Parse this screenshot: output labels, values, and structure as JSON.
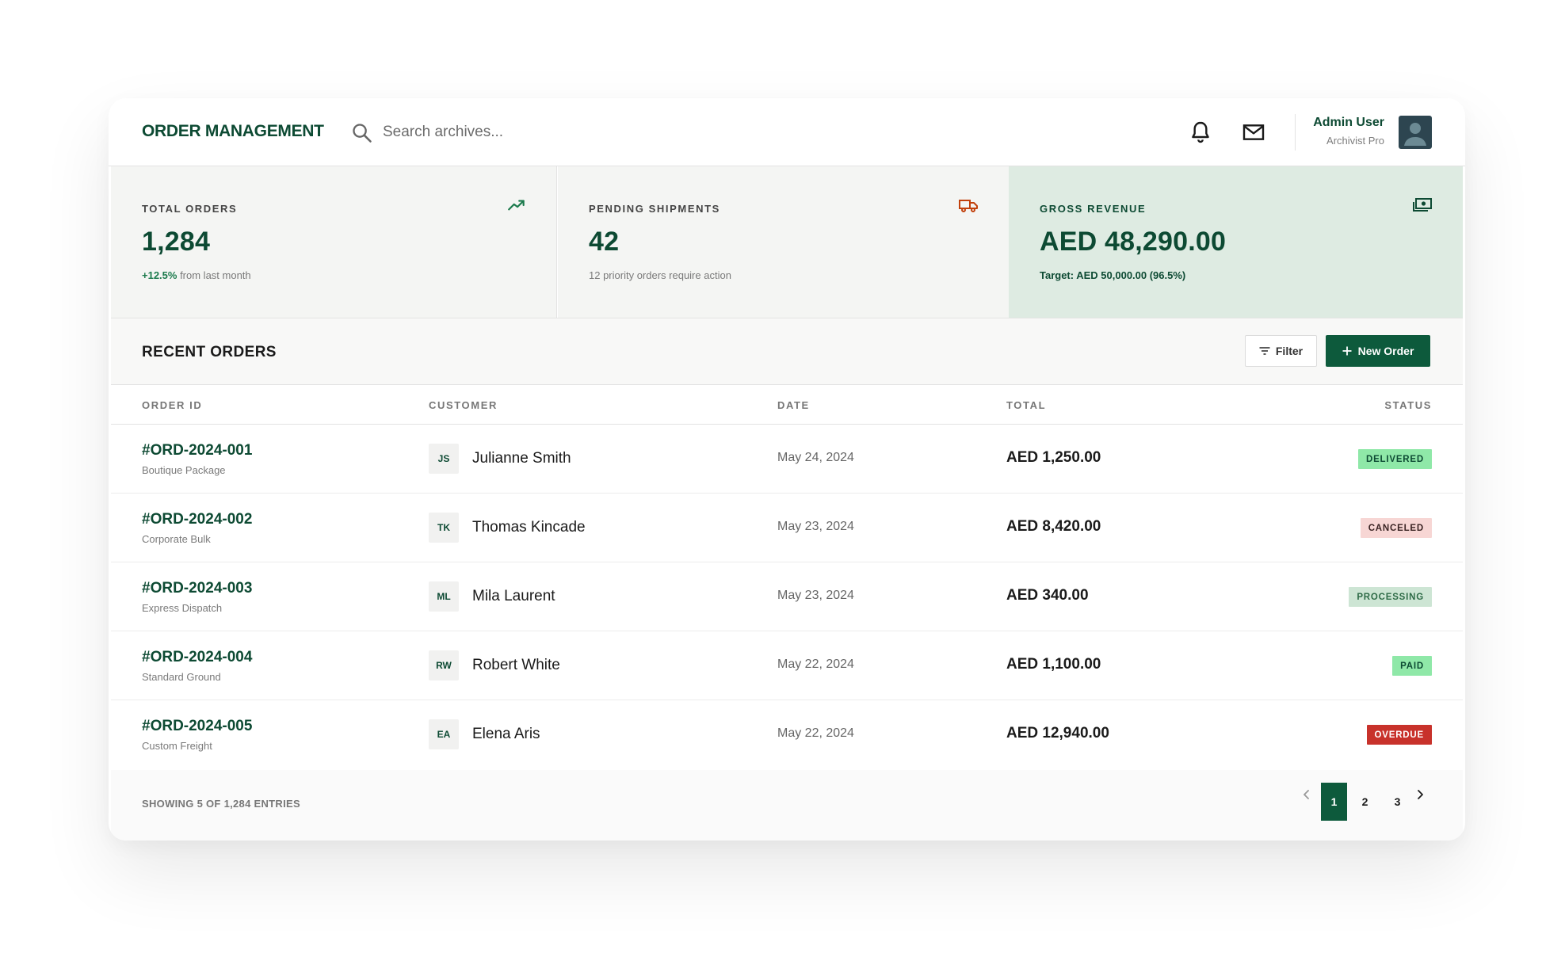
{
  "header": {
    "logo": "ORDER MANAGEMENT",
    "search_placeholder": "Search archives...",
    "user_name": "Admin User",
    "user_role": "Archivist Pro"
  },
  "stats": [
    {
      "label": "TOTAL ORDERS",
      "value": "1,284",
      "sub_highlight": "+12.5%",
      "sub_text": " from last month",
      "icon": "trending-up-icon"
    },
    {
      "label": "PENDING SHIPMENTS",
      "value": "42",
      "sub_text": "12 priority orders require action",
      "icon": "truck-icon"
    },
    {
      "label": "GROSS REVENUE",
      "value": "AED 48,290.00",
      "sub_text": "Target: AED 50,000.00 (96.5%)",
      "icon": "cash-icon"
    }
  ],
  "orders": {
    "title": "RECENT ORDERS",
    "filter_label": "Filter",
    "new_order_label": "New Order",
    "columns": [
      "ORDER ID",
      "CUSTOMER",
      "DATE",
      "TOTAL",
      "STATUS"
    ],
    "rows": [
      {
        "id": "#ORD-2024-001",
        "type": "Boutique Package",
        "initials": "JS",
        "customer": "Julianne Smith",
        "date": "May 24, 2024",
        "total": "AED 1,250.00",
        "status": "DELIVERED",
        "status_key": "delivered"
      },
      {
        "id": "#ORD-2024-002",
        "type": "Corporate Bulk",
        "initials": "TK",
        "customer": "Thomas Kincade",
        "date": "May 23, 2024",
        "total": "AED 8,420.00",
        "status": "CANCELED",
        "status_key": "canceled"
      },
      {
        "id": "#ORD-2024-003",
        "type": "Express Dispatch",
        "initials": "ML",
        "customer": "Mila Laurent",
        "date": "May 23, 2024",
        "total": "AED 340.00",
        "status": "PROCESSING",
        "status_key": "processing"
      },
      {
        "id": "#ORD-2024-004",
        "type": "Standard Ground",
        "initials": "RW",
        "customer": "Robert White",
        "date": "May 22, 2024",
        "total": "AED 1,100.00",
        "status": "PAID",
        "status_key": "paid"
      },
      {
        "id": "#ORD-2024-005",
        "type": "Custom Freight",
        "initials": "EA",
        "customer": "Elena Aris",
        "date": "May 22, 2024",
        "total": "AED 12,940.00",
        "status": "OVERDUE",
        "status_key": "overdue"
      }
    ],
    "showing": "SHOWING 5 OF 1,284 ENTRIES",
    "pages": [
      "1",
      "2",
      "3"
    ],
    "active_page": "1"
  },
  "colors": {
    "brand": "#0d4a33",
    "accent": "#0d5a3c",
    "revenue_bg": "#deebe2",
    "pending_icon": "#c2410c"
  }
}
